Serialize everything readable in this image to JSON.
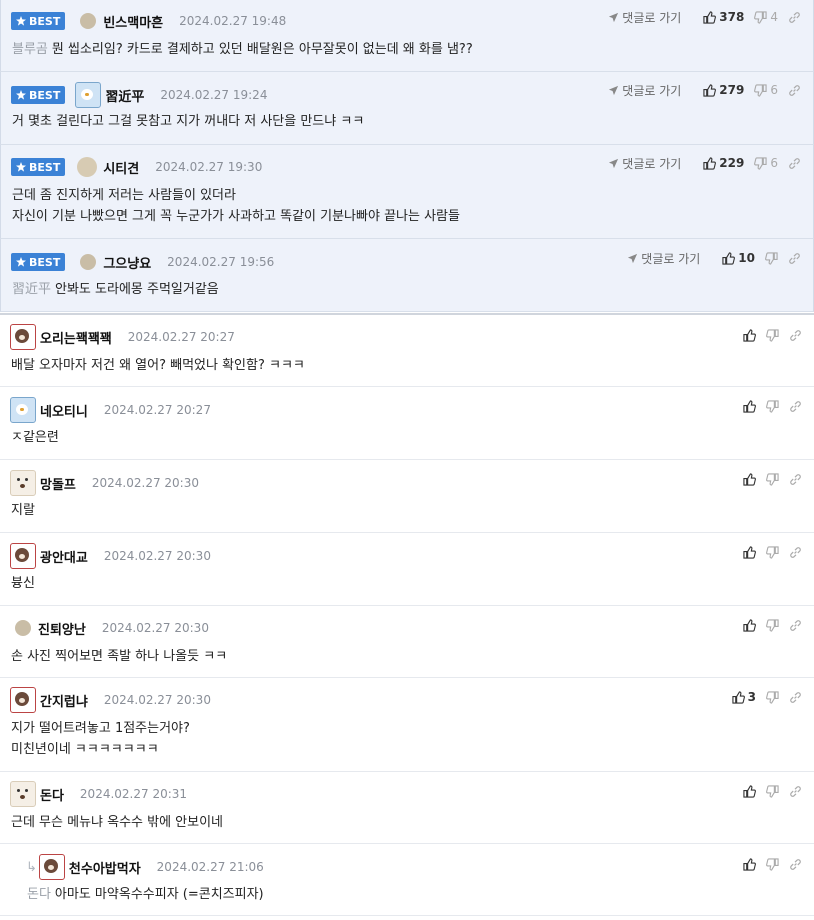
{
  "labels": {
    "best": "BEST",
    "goto": "댓글로 가기"
  },
  "comments": [
    {
      "best": true,
      "nick": "빈스맥마흔",
      "date": "2024.02.27 19:48",
      "cite": "블루곰",
      "text": "뭔 씹소리임? 카드로 결제하고 있던 배달원은 아무잘못이 없는데 왜 화를 냄??",
      "up": "378",
      "down": "4",
      "avatar": "dot"
    },
    {
      "best": true,
      "nick": "習近平",
      "date": "2024.02.27 19:24",
      "cite": "",
      "text": "거 몇초 걸린다고 그걸 못참고 지가 꺼내다 저 사단을 만드냐 ㅋㅋ",
      "up": "279",
      "down": "6",
      "avatar": "bird"
    },
    {
      "best": true,
      "nick": "시티견",
      "date": "2024.02.27 19:30",
      "cite": "",
      "text": "근데 좀 진지하게 저러는 사람들이 있더라",
      "text2": "자신이 기분 나빴으면 그게 꼭 누군가가 사과하고 똑같이 기분나빠야 끝나는 사람들",
      "up": "229",
      "down": "6",
      "avatar": "round"
    },
    {
      "best": true,
      "nick": "그으냥요",
      "date": "2024.02.27 19:56",
      "cite": "習近平",
      "text": "안봐도 도라에몽 주먹일거같음",
      "up": "10",
      "down": "",
      "avatar": "dot"
    },
    {
      "best": false,
      "nick": "오리는꽥꽥꽥",
      "date": "2024.02.27 20:27",
      "text": "배달 오자마자 저건 왜 열어? 빼먹었나 확인함? ㅋㅋㅋ",
      "up": "",
      "avatar": "bear"
    },
    {
      "best": false,
      "nick": "네오티니",
      "date": "2024.02.27 20:27",
      "text": "ㅈ같은련",
      "up": "",
      "avatar": "bird"
    },
    {
      "best": false,
      "nick": "망돌프",
      "date": "2024.02.27 20:30",
      "text": "지랄",
      "up": "",
      "avatar": "dog"
    },
    {
      "best": false,
      "nick": "광안대교",
      "date": "2024.02.27 20:30",
      "text": "븅신",
      "up": "",
      "avatar": "bear"
    },
    {
      "best": false,
      "nick": "진퇴양난",
      "date": "2024.02.27 20:30",
      "text": "손 사진 찍어보면 족발 하나 나올듯 ㅋㅋ",
      "up": "",
      "avatar": "dot"
    },
    {
      "best": false,
      "nick": "간지럽냐",
      "date": "2024.02.27 20:30",
      "text": "지가 떨어트려놓고 1점주는거야?",
      "text2": "미친년이네 ㅋㅋㅋㅋㅋㅋㅋ",
      "up": "3",
      "avatar": "bear"
    },
    {
      "best": false,
      "nick": "돈다",
      "date": "2024.02.27 20:31",
      "text": "근데 무슨 메뉴냐 옥수수 밖에 안보이네",
      "up": "",
      "avatar": "dog"
    },
    {
      "best": false,
      "reply": true,
      "nick": "천수아밥먹자",
      "date": "2024.02.27 21:06",
      "cite": "돈다",
      "text": "아마도 마약옥수수피자 (=콘치즈피자)",
      "up": "",
      "avatar": "bear"
    }
  ]
}
